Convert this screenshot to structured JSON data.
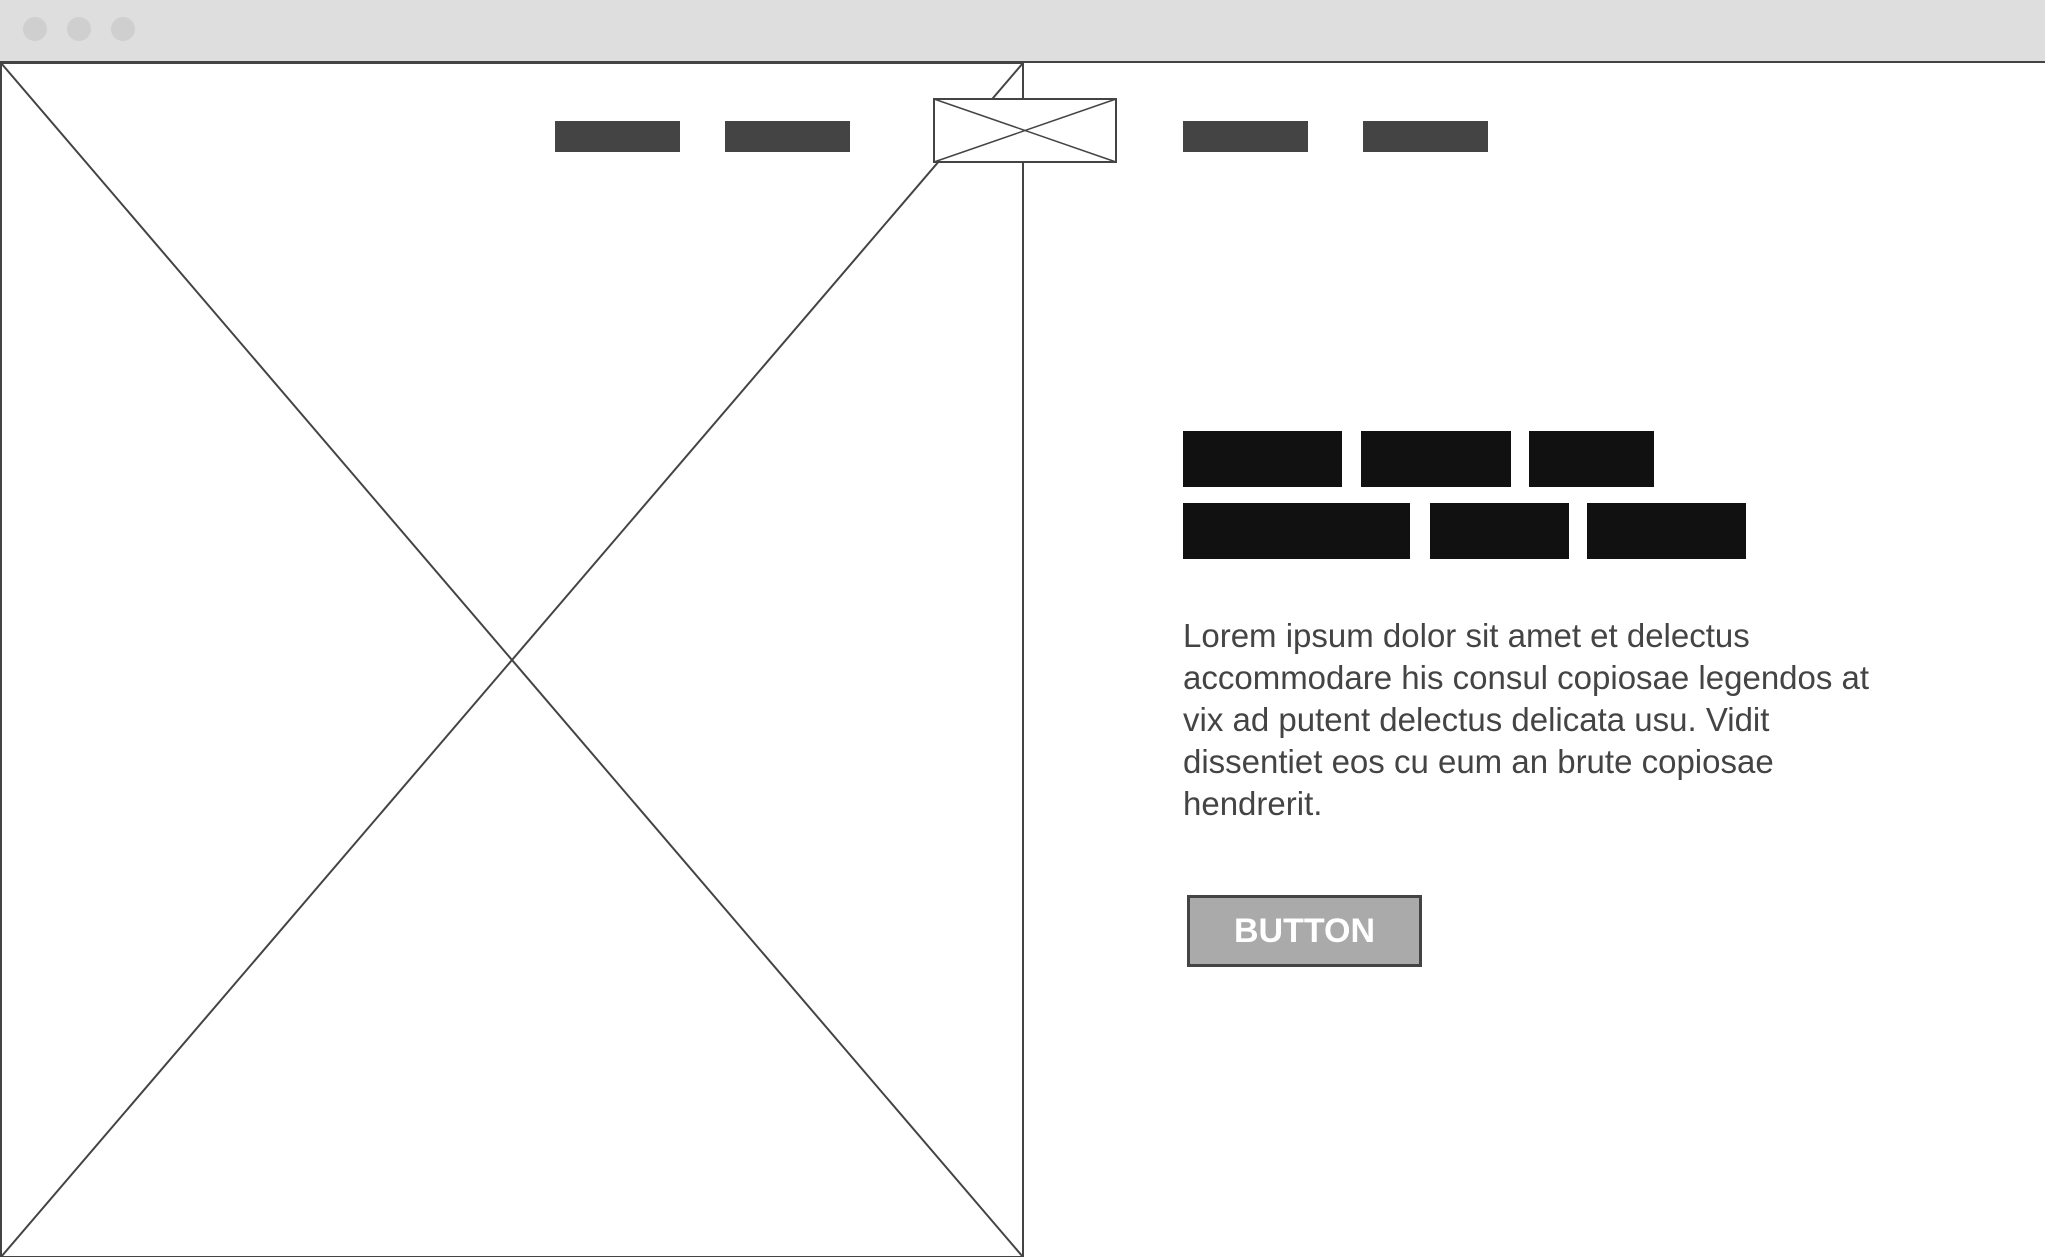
{
  "window": {
    "titlebar_color": "#dedede",
    "traffic_light_color": "#cfcfcf"
  },
  "hero": {
    "image_icon": "image-placeholder-icon"
  },
  "nav": {
    "links": [
      {
        "placeholder": "nav-link-placeholder"
      },
      {
        "placeholder": "nav-link-placeholder"
      },
      {
        "placeholder": "nav-link-placeholder"
      },
      {
        "placeholder": "nav-link-placeholder"
      }
    ],
    "logo_icon": "logo-placeholder-icon",
    "link_color": "#444444"
  },
  "content": {
    "headline_color": "#111111",
    "body": "Lorem ipsum dolor sit amet et delectus accommodare his consul copiosae legendos at vix ad putent delectus delicata usu. Vidit dissentiet eos cu eum an brute copiosae hendrerit.",
    "button_label": "BUTTON",
    "button_color": "#aaaaaa"
  }
}
